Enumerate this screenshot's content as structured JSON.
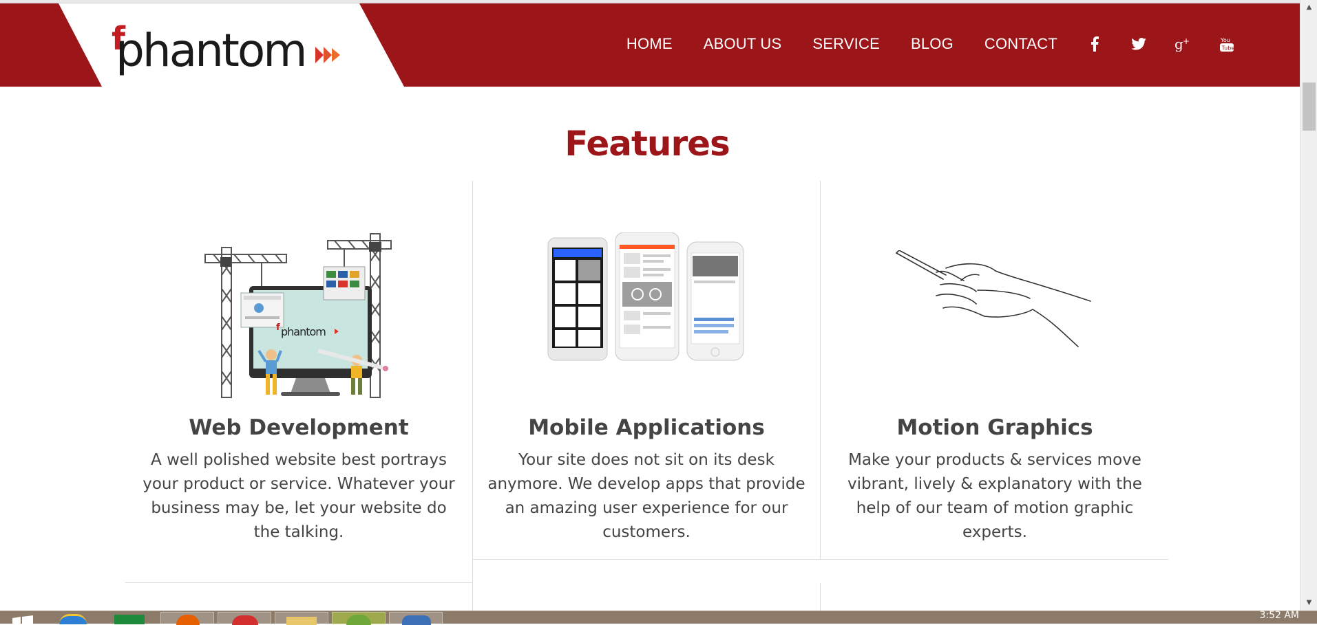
{
  "brand": {
    "logo_alt": "phantom",
    "logo_letter": "f",
    "logo_word": "phantom"
  },
  "nav": {
    "links": [
      "HOME",
      "ABOUT US",
      "SERVICE",
      "BLOG",
      "CONTACT"
    ],
    "social": [
      "facebook-icon",
      "twitter-icon",
      "google-plus-icon",
      "youtube-icon"
    ]
  },
  "section": {
    "title": "Features"
  },
  "features": [
    {
      "title": "Web Development",
      "description": "A well polished website best portrays your product or service. Whatever your business may be, let your website do the talking.",
      "illustration_word": "phantom"
    },
    {
      "title": "Mobile Applications",
      "description": "Your site does not sit on its desk anymore. We develop apps that provide an amazing user experience for our customers."
    },
    {
      "title": "Motion Graphics",
      "description": "Make your products & services move vibrant, lively & explanatory with the help of our team of motion graphic experts."
    }
  ],
  "taskbar": {
    "clock": "3:52 AM"
  },
  "colors": {
    "brand_red": "#9b1519",
    "text_gray": "#444444",
    "divider": "#dcdcdc"
  }
}
